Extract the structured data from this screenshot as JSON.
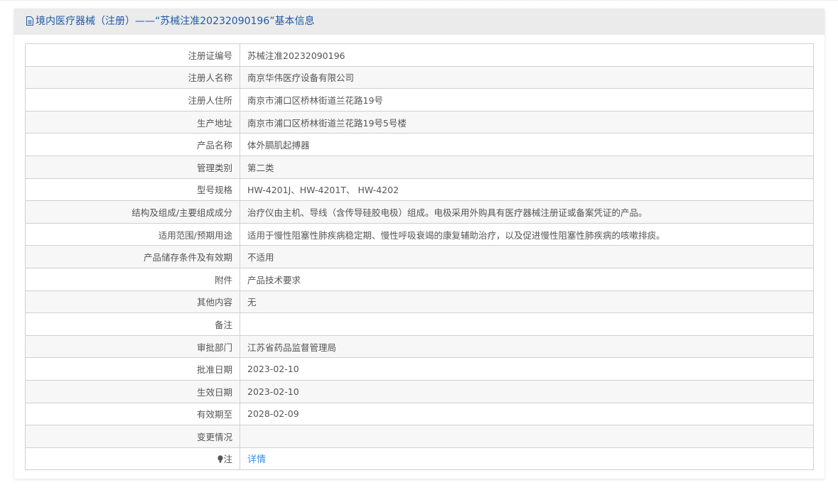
{
  "header": {
    "title": "境内医疗器械（注册）——“苏械注准20232090196”基本信息",
    "icon": "document-icon"
  },
  "rows": [
    {
      "label": "注册证编号",
      "value": "苏械注准20232090196"
    },
    {
      "label": "注册人名称",
      "value": "南京华伟医疗设备有限公司"
    },
    {
      "label": "注册人住所",
      "value": "南京市浦口区桥林街道兰花路19号"
    },
    {
      "label": "生产地址",
      "value": "南京市浦口区桥林街道兰花路19号5号楼"
    },
    {
      "label": "产品名称",
      "value": "体外膈肌起搏器"
    },
    {
      "label": "管理类别",
      "value": "第二类"
    },
    {
      "label": "型号规格",
      "value": "HW-4201J、HW-4201T、 HW-4202"
    },
    {
      "label": "结构及组成/主要组成成分",
      "value": "治疗仪由主机、导线（含传导硅胶电极）组成。电极采用外购具有医疗器械注册证或备案凭证的产品。"
    },
    {
      "label": "适用范围/预期用途",
      "value": "适用于慢性阻塞性肺疾病稳定期、慢性呼吸衰竭的康复辅助治疗，以及促进慢性阻塞性肺疾病的咳嗽排痰。"
    },
    {
      "label": "产品储存条件及有效期",
      "value": "不适用"
    },
    {
      "label": "附件",
      "value": "产品技术要求"
    },
    {
      "label": "其他内容",
      "value": "无"
    },
    {
      "label": "备注",
      "value": ""
    },
    {
      "label": "审批部门",
      "value": "江苏省药品监督管理局"
    },
    {
      "label": "批准日期",
      "value": "2023-02-10"
    },
    {
      "label": "生效日期",
      "value": "2023-02-10"
    },
    {
      "label": "有效期至",
      "value": "2028-02-09"
    },
    {
      "label": "变更情况",
      "value": ""
    }
  ],
  "note": {
    "label": "注",
    "icon": "bulb-icon",
    "link": "详情"
  }
}
